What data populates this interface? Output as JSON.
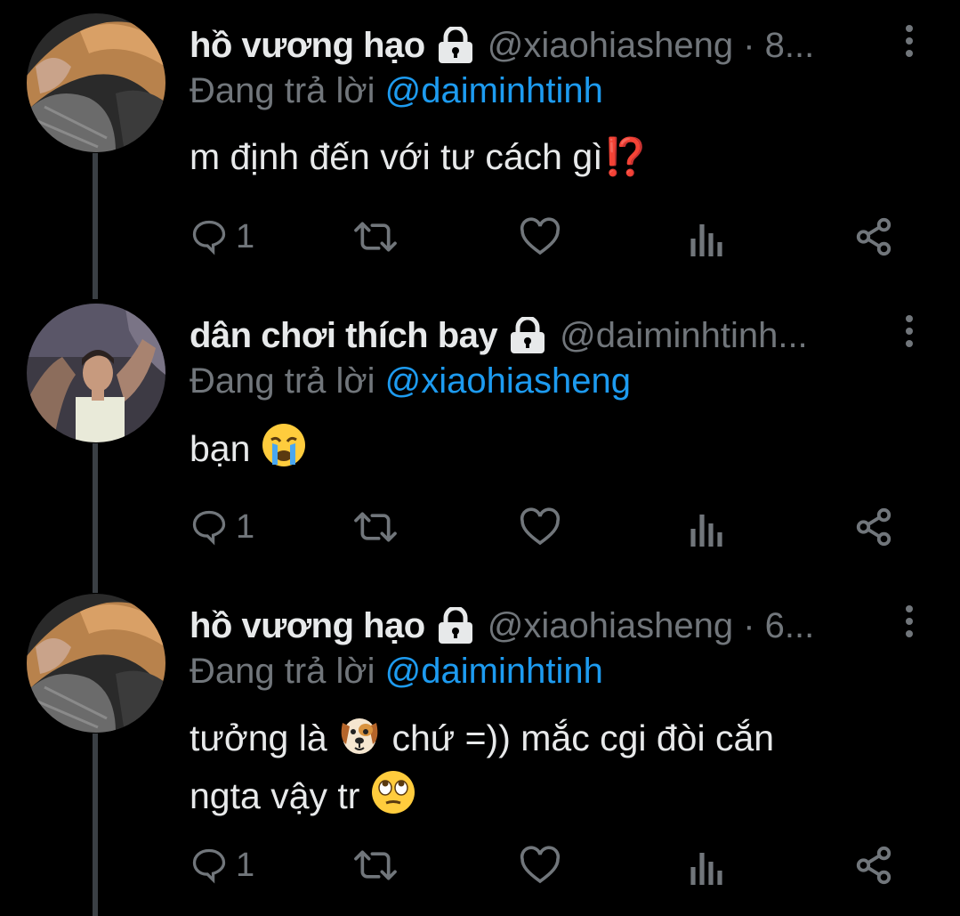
{
  "tweets": [
    {
      "name": "hồ vương hạo",
      "handle": "@xiaohiasheng · 8...",
      "replying_prefix": "Đang trả lời",
      "replying_to": "@daiminhtinh",
      "text": "m định đến với tư cách gì",
      "text_emoji": "⁉️",
      "reply_count": "1",
      "avatar": "avatar-hair-closeup"
    },
    {
      "name": "dân chơi thích bay",
      "handle": "@daiminhtinh...",
      "replying_prefix": "Đang trả lời",
      "replying_to": "@xiaohiasheng",
      "text": "bạn",
      "text_emoji": "😭",
      "reply_count": "1",
      "avatar": "avatar-party-photo"
    },
    {
      "name": "hồ vương hạo",
      "handle": "@xiaohiasheng · 6...",
      "replying_prefix": "Đang trả lời",
      "replying_to": "@daiminhtinh",
      "text_line1_a": "tưởng là",
      "emoji_dog": "🐶",
      "text_line1_b": "chứ =)) mắc cgi đòi cắn",
      "text_line2": "ngta vậy tr",
      "emoji_eyes": "🙄",
      "reply_count": "1",
      "avatar": "avatar-hair-closeup"
    }
  ],
  "icons": [
    "lock-icon",
    "more-icon",
    "reply-icon",
    "retweet-icon",
    "like-icon",
    "views-icon",
    "share-icon"
  ],
  "colors": {
    "background": "#000000",
    "text": "#e7e9ea",
    "muted": "#71767b",
    "link": "#1d9bf0",
    "thread": "#3a3f44"
  }
}
